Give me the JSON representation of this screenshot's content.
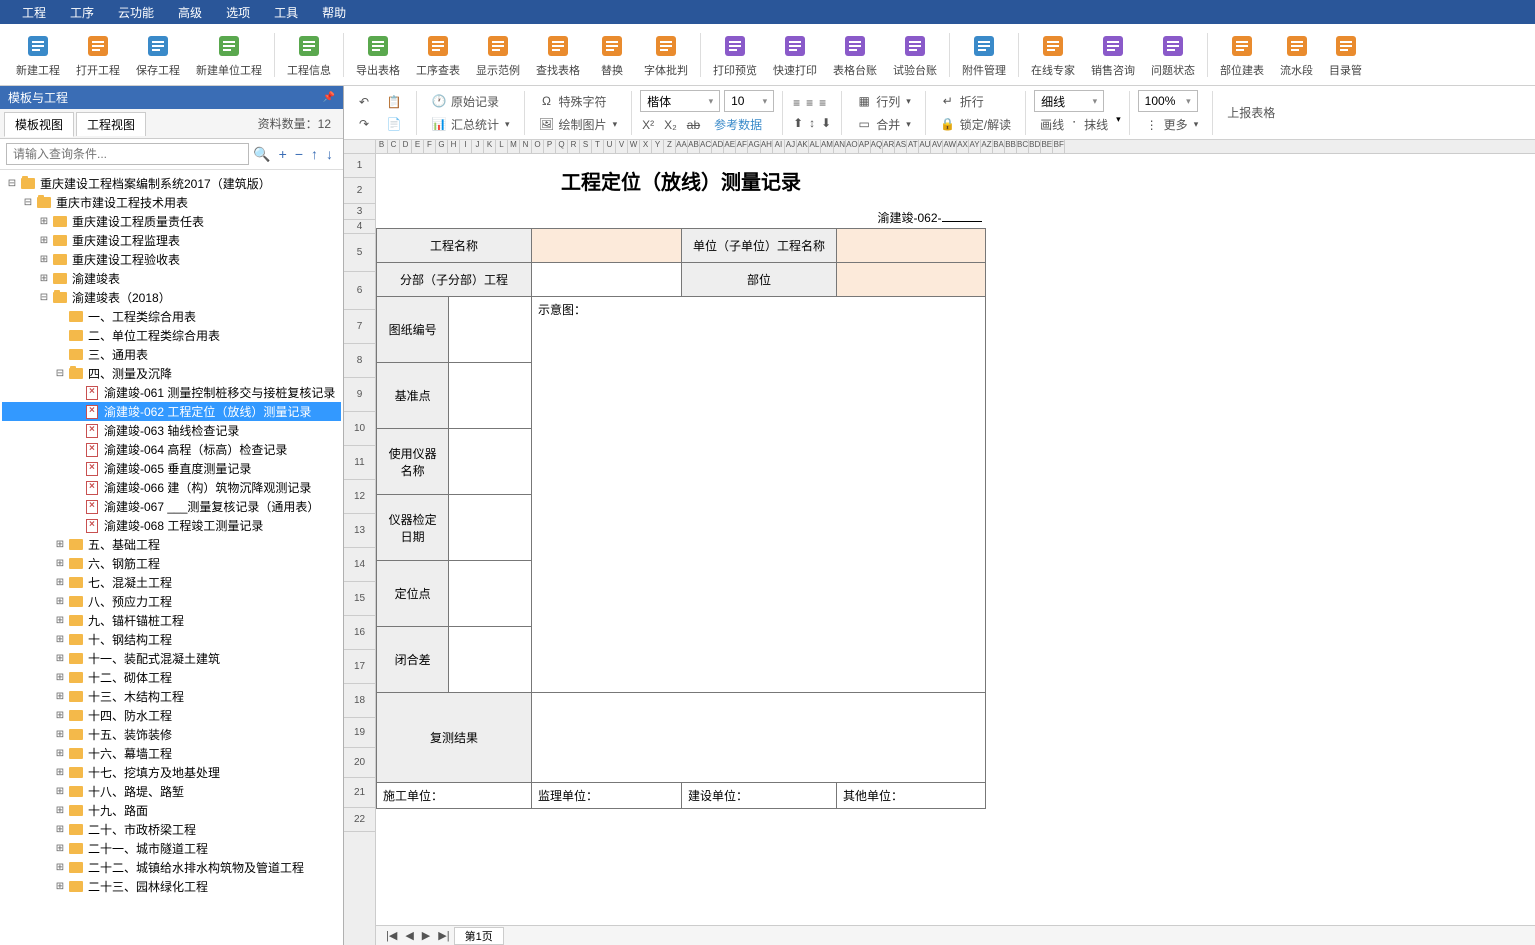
{
  "menu": [
    "工程",
    "工序",
    "云功能",
    "高级",
    "选项",
    "工具",
    "帮助"
  ],
  "toolbar": [
    {
      "label": "新建工程",
      "color": "#3a8ac9",
      "icon": "doc"
    },
    {
      "label": "打开工程",
      "color": "#e98b2e",
      "icon": "folder-open"
    },
    {
      "label": "保存工程",
      "color": "#3a8ac9",
      "icon": "save"
    },
    {
      "label": "新建单位工程",
      "color": "#5aa84e",
      "icon": "home"
    },
    {
      "label": "工程信息",
      "color": "#5aa84e",
      "icon": "info"
    },
    {
      "label": "导出表格",
      "color": "#5aa84e",
      "icon": "export"
    },
    {
      "label": "工序查表",
      "color": "#e98b2e",
      "icon": "list"
    },
    {
      "label": "显示范例",
      "color": "#e98b2e",
      "icon": "example"
    },
    {
      "label": "查找表格",
      "color": "#e98b2e",
      "icon": "search"
    },
    {
      "label": "替换",
      "color": "#e98b2e",
      "icon": "replace"
    },
    {
      "label": "字体批判",
      "color": "#e98b2e",
      "icon": "font"
    },
    {
      "label": "打印预览",
      "color": "#8a5ac9",
      "icon": "preview"
    },
    {
      "label": "快速打印",
      "color": "#8a5ac9",
      "icon": "print"
    },
    {
      "label": "表格台账",
      "color": "#8a5ac9",
      "icon": "ledger"
    },
    {
      "label": "试验台账",
      "color": "#8a5ac9",
      "icon": "test"
    },
    {
      "label": "附件管理",
      "color": "#3a8ac9",
      "icon": "attach"
    },
    {
      "label": "在线专家",
      "color": "#e98b2e",
      "icon": "expert"
    },
    {
      "label": "销售咨询",
      "color": "#8a5ac9",
      "icon": "sales"
    },
    {
      "label": "问题状态",
      "color": "#8a5ac9",
      "icon": "question"
    },
    {
      "label": "部位建表",
      "color": "#e98b2e",
      "icon": "part"
    },
    {
      "label": "流水段",
      "color": "#e98b2e",
      "icon": "flow"
    },
    {
      "label": "目录管",
      "color": "#e98b2e",
      "icon": "catalog"
    }
  ],
  "sidebar": {
    "title": "模板与工程",
    "tabs": [
      "模板视图",
      "工程视图"
    ],
    "count_label": "资料数量：12",
    "search_placeholder": "请输入查询条件...",
    "root": "重庆建设工程档案编制系统2017（建筑版）",
    "lvl1": "重庆市建设工程技术用表",
    "lvl2": [
      "重庆建设工程质量责任表",
      "重庆建设工程监理表",
      "重庆建设工程验收表",
      "渝建竣表"
    ],
    "lvl2_open": "渝建竣表（2018）",
    "lvl3": [
      "一、工程类综合用表",
      "二、单位工程类综合用表",
      "三、通用表"
    ],
    "lvl3_open": "四、测量及沉降",
    "docs": [
      "渝建竣-061 测量控制桩移交与接桩复核记录",
      "渝建竣-062 工程定位（放线）测量记录",
      "渝建竣-063 轴线检查记录",
      "渝建竣-064 高程（标高）检查记录",
      "渝建竣-065 垂直度测量记录",
      "渝建竣-066 建（构）筑物沉降观测记录",
      "渝建竣-067 ___测量复核记录（通用表）",
      "渝建竣-068 工程竣工测量记录"
    ],
    "selected_doc_idx": 1,
    "lvl3_after": [
      "五、基础工程",
      "六、钢筋工程",
      "七、混凝土工程",
      "八、预应力工程",
      "九、锚杆锚桩工程",
      "十、钢结构工程",
      "十一、装配式混凝土建筑",
      "十二、砌体工程",
      "十三、木结构工程",
      "十四、防水工程",
      "十五、装饰装修",
      "十六、幕墙工程",
      "十七、挖填方及地基处理",
      "十八、路堤、路堑",
      "十九、路面",
      "二十、市政桥梁工程",
      "二十一、城市隧道工程",
      "二十二、城镇给水排水构筑物及管道工程",
      "二十三、园林绿化工程"
    ]
  },
  "ribbon": {
    "row1": {
      "original": "原始记录",
      "special": "特殊字符",
      "font": "楷体",
      "size": "10",
      "rowcol": "行列",
      "wrap": "折行",
      "line": "细线",
      "zoom": "100%",
      "upload": "上报表格"
    },
    "row2": {
      "stats": "汇总统计",
      "draw": "绘制图片",
      "ref": "参考数据",
      "merge": "合并",
      "lock": "锁定/解读",
      "drawline": "画线",
      "wipe": "抹线",
      "more": "更多"
    }
  },
  "sheet": {
    "title": "工程定位（放线）测量记录",
    "code": "渝建竣-062-",
    "fields": {
      "proj_name": "工程名称",
      "unit_name": "单位（子单位）工程名称",
      "subpart": "分部（子分部）工程",
      "part": "部位",
      "diagram": "示意图：",
      "drawing_no": "图纸编号",
      "datum": "基准点",
      "instrument": "使用仪器\n名称",
      "calib": "仪器检定\n日期",
      "locate": "定位点",
      "closure": "闭合差",
      "retest": "复测结果",
      "cons": "施工单位：",
      "super": "监理单位：",
      "build": "建设单位：",
      "other": "其他单位："
    },
    "rownums": [
      "1",
      "2",
      "3",
      "4",
      "5",
      "6",
      "7",
      "8",
      "9",
      "10",
      "11",
      "12",
      "13",
      "14",
      "15",
      "16",
      "17",
      "18",
      "19",
      "20",
      "21",
      "22"
    ],
    "cols": [
      "B",
      "C",
      "D",
      "E",
      "F",
      "G",
      "H",
      "I",
      "J",
      "K",
      "L",
      "M",
      "N",
      "O",
      "P",
      "Q",
      "R",
      "S",
      "T",
      "U",
      "V",
      "W",
      "X",
      "Y",
      "Z",
      "AA",
      "AB",
      "AC",
      "AD",
      "AE",
      "AF",
      "AG",
      "AH",
      "AI",
      "AJ",
      "AK",
      "AL",
      "AM",
      "AN",
      "AO",
      "AP",
      "AQ",
      "AR",
      "AS",
      "AT",
      "AU",
      "AV",
      "AW",
      "AX",
      "AY",
      "AZ",
      "BA",
      "BB",
      "BC",
      "BD",
      "BE",
      "BF"
    ],
    "page": "第1页"
  }
}
